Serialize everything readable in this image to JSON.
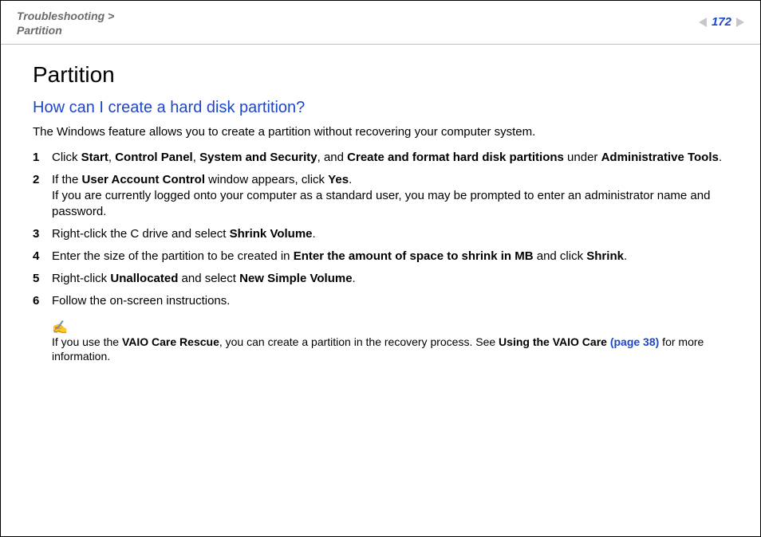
{
  "breadcrumb": {
    "parent": "Troubleshooting",
    "sep": " > ",
    "current": "Partition"
  },
  "pageNumber": "172",
  "title": "Partition",
  "question": "How can I create a hard disk partition?",
  "intro": "The Windows feature allows you to create a partition without recovering your computer system.",
  "steps": [
    {
      "n": "1",
      "pre1": "Click ",
      "b1": "Start",
      "sep1": ", ",
      "b2": "Control Panel",
      "sep2": ", ",
      "b3": "System and Security",
      "sep3": ", and ",
      "b4": "Create and format hard disk partitions",
      "sep4": " under ",
      "b5": "Administrative Tools",
      "post": "."
    },
    {
      "n": "2",
      "pre1": "If the ",
      "b1": "User Account Control",
      "mid1": " window appears, click ",
      "b2": "Yes",
      "post1": ".",
      "line2": "If you are currently logged onto your computer as a standard user, you may be prompted to enter an administrator name and password."
    },
    {
      "n": "3",
      "pre1": "Right-click the C drive and select ",
      "b1": "Shrink Volume",
      "post": "."
    },
    {
      "n": "4",
      "pre1": "Enter the size of the partition to be created in ",
      "b1": "Enter the amount of space to shrink in MB",
      "mid1": " and click ",
      "b2": "Shrink",
      "post": "."
    },
    {
      "n": "5",
      "pre1": "Right-click ",
      "b1": "Unallocated",
      "mid1": " and select ",
      "b2": "New Simple Volume",
      "post": "."
    },
    {
      "n": "6",
      "pre1": "Follow the on-screen instructions."
    }
  ],
  "note": {
    "icon": "✍",
    "pre1": "If you use the ",
    "b1": "VAIO Care Rescue",
    "mid1": ", you can create a partition in the recovery process. See ",
    "b2": "Using the VAIO Care ",
    "link": "(page 38)",
    "post": " for more information."
  }
}
